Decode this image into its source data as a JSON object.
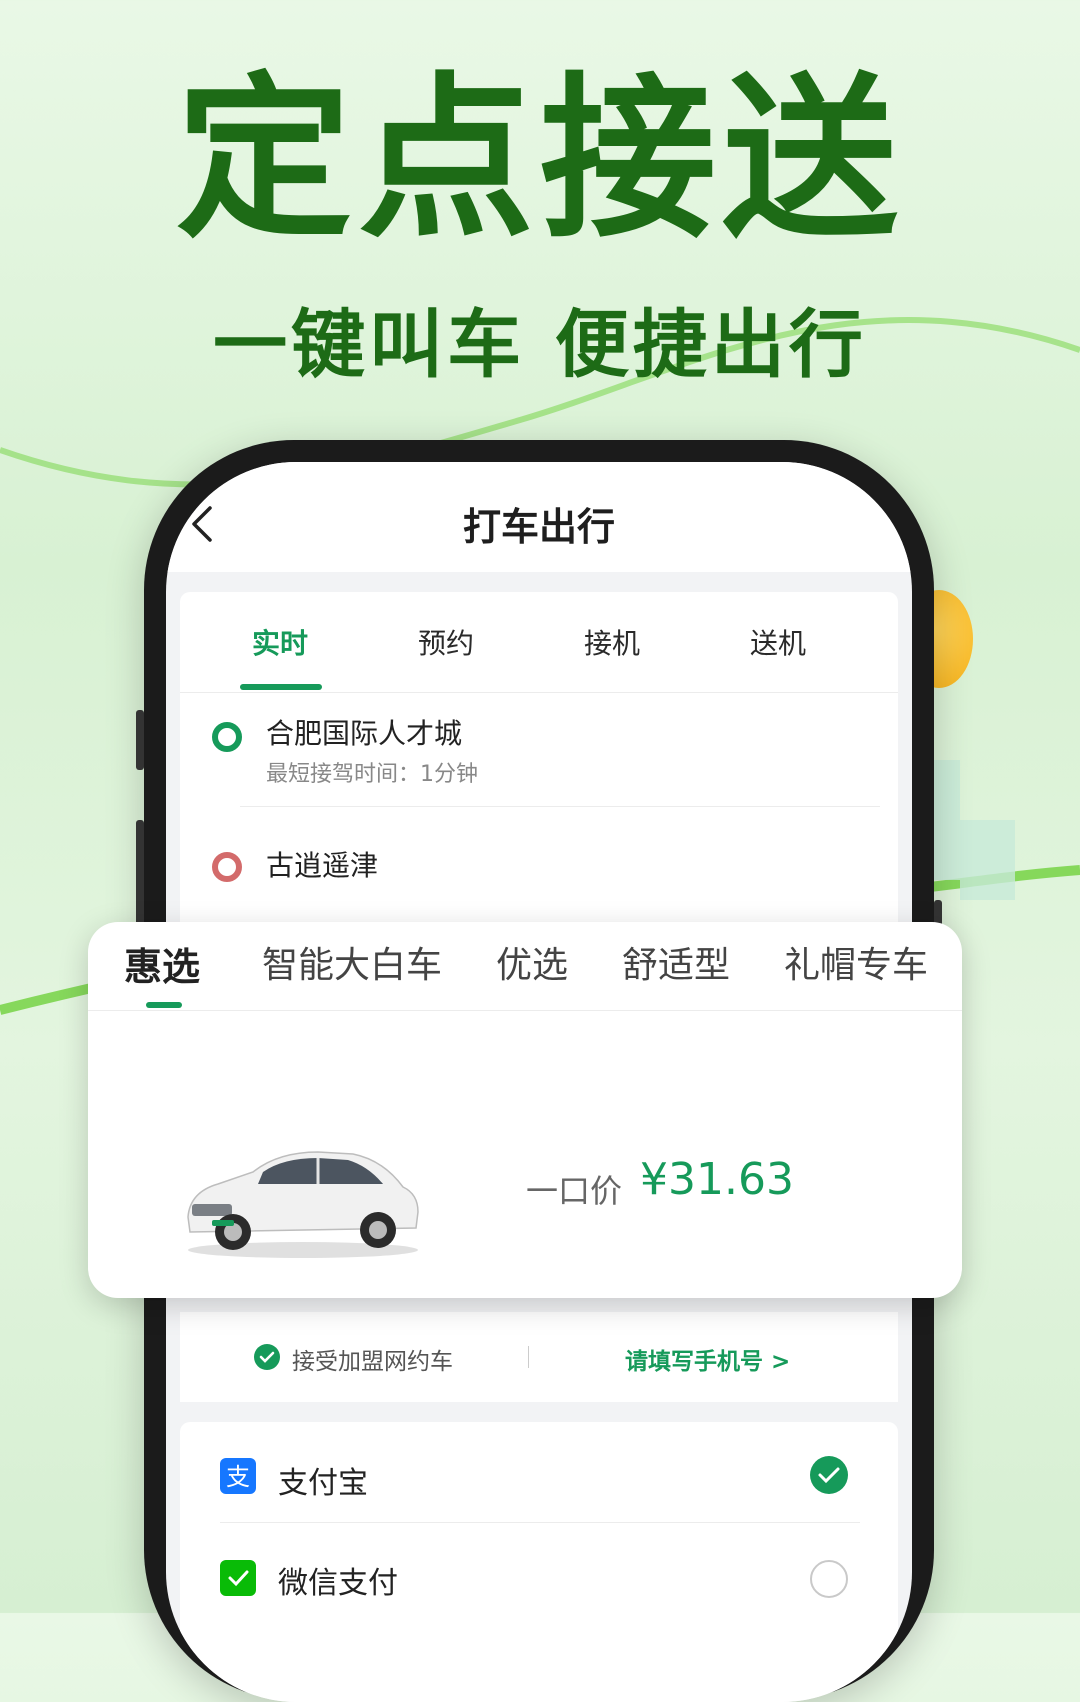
{
  "promo": {
    "headline": "定点接送",
    "subline": "一键叫车 便捷出行"
  },
  "nav": {
    "title": "打车出行",
    "back_icon": "chevron-left-icon"
  },
  "tabs": [
    {
      "label": "实时",
      "active": true
    },
    {
      "label": "预约",
      "active": false
    },
    {
      "label": "接机",
      "active": false
    },
    {
      "label": "送机",
      "active": false
    }
  ],
  "route": {
    "origin": {
      "title": "合肥国际人才城",
      "subtitle": "最短接驾时间：1分钟",
      "color": "#169a5a"
    },
    "destination": {
      "title": "古逍遥津",
      "color": "#d36b6b"
    }
  },
  "car_types": [
    {
      "label": "惠选",
      "active": true
    },
    {
      "label": "智能大白车",
      "active": false
    },
    {
      "label": "优选",
      "active": false
    },
    {
      "label": "舒适型",
      "active": false
    },
    {
      "label": "礼帽专车",
      "active": false
    }
  ],
  "quote": {
    "price_label": "一口价",
    "price": "¥31.63"
  },
  "options": {
    "accept_text": "接受加盟网约车",
    "phone_link": "请填写手机号 >"
  },
  "payment": [
    {
      "label": "支付宝",
      "icon": "alipay-icon",
      "selected": true,
      "color": "#1677ff"
    },
    {
      "label": "微信支付",
      "icon": "wechat-pay-icon",
      "selected": false,
      "color": "#09bb07"
    }
  ],
  "colors": {
    "accent": "#169a5a",
    "headline": "#1d6b16"
  }
}
